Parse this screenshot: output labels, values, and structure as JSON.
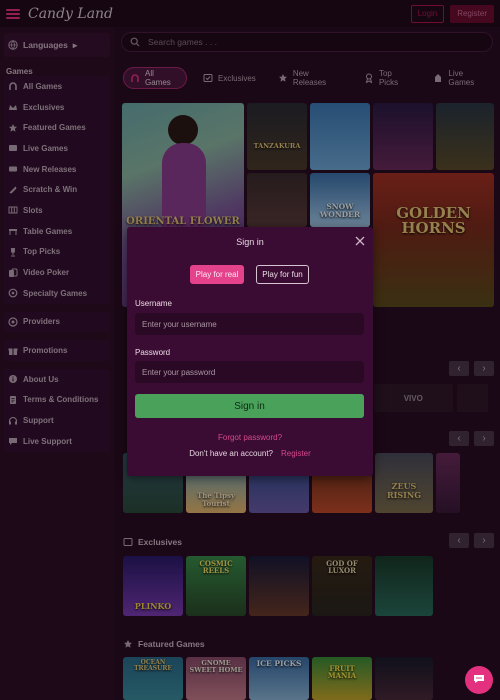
{
  "header": {
    "logo_text": "Candy Land",
    "login_label": "Login",
    "register_label": "Register"
  },
  "sidebar": {
    "languages_label": "Languages",
    "games_heading": "Games",
    "games_items": [
      {
        "label": "All Games",
        "icon": "horseshoe-icon"
      },
      {
        "label": "Exclusives",
        "icon": "crown-icon"
      },
      {
        "label": "Featured Games",
        "icon": "star-icon"
      },
      {
        "label": "Live Games",
        "icon": "live-icon"
      },
      {
        "label": "New Releases",
        "icon": "new-icon"
      },
      {
        "label": "Scratch & Win",
        "icon": "scratch-icon"
      },
      {
        "label": "Slots",
        "icon": "slot-icon"
      },
      {
        "label": "Table Games",
        "icon": "table-icon"
      },
      {
        "label": "Top Picks",
        "icon": "trophy-icon"
      },
      {
        "label": "Video Poker",
        "icon": "cards-icon"
      },
      {
        "label": "Specialty Games",
        "icon": "specialty-icon"
      }
    ],
    "providers_label": "Providers",
    "promotions_label": "Promotions",
    "info_items": [
      {
        "label": "About Us",
        "icon": "info-icon"
      },
      {
        "label": "Terms & Conditions",
        "icon": "document-icon"
      },
      {
        "label": "Support",
        "icon": "support-icon"
      },
      {
        "label": "Live Support",
        "icon": "chat-icon"
      }
    ]
  },
  "search": {
    "placeholder": "Search games . . ."
  },
  "categories": [
    {
      "label": "All Games",
      "active": true
    },
    {
      "label": "Exclusives",
      "active": false
    },
    {
      "label": "New Releases",
      "active": false
    },
    {
      "label": "Top Picks",
      "active": false
    },
    {
      "label": "Live Games",
      "active": false
    }
  ],
  "hero_tiles": {
    "oriental_flower": "ORIENTAL FLOWER",
    "tanzakura": "TANZAKURA",
    "snow_wonder": "SNOW WONDER",
    "golden_horns": "GOLDEN HORNS"
  },
  "sections": {
    "exclusives": "Exclusives",
    "featured": "Featured Games"
  },
  "section_tiles": {
    "tipsy_tourist": "The Tipsy Tourist",
    "zeus_rising": "ZEUS RISING",
    "plinko": "PLINKO",
    "cosmic_reels": "COSMIC REELS",
    "god_of_luxor": "GOD OF LUXOR",
    "ocean_treasure": "OCEAN TREASURE",
    "gnome_sweet_home": "GNOME SWEET HOME",
    "ice_picks": "ICE PICKS",
    "fruit_mania": "FRUIT MANIA"
  },
  "providers": {
    "vivo": "VIVO"
  },
  "modal": {
    "title": "Sign in",
    "play_real": "Play for real",
    "play_fun": "Play for fun",
    "username_label": "Username",
    "username_placeholder": "Enter your username",
    "password_label": "Password",
    "password_placeholder": "Enter your password",
    "signin_label": "Sign in",
    "forgot_label": "Forgot password?",
    "no_account_label": "Don't have an account?",
    "register_link": "Register"
  },
  "colors": {
    "accent_pink": "#e3317f",
    "signin_green": "#4aa25a",
    "page_bg": "#2a0d23"
  }
}
